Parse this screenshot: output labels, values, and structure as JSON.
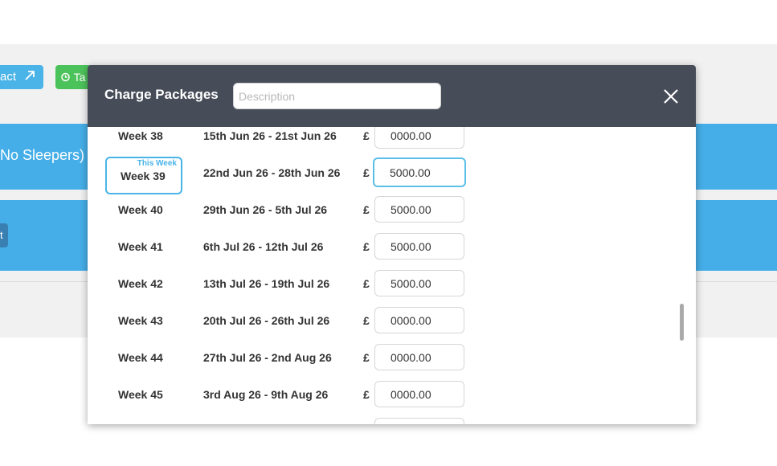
{
  "background": {
    "contract_button_label": "act",
    "task_button_label": "Ta",
    "band_label": "No Sleepers)",
    "band2_tab_label": "t"
  },
  "modal": {
    "title": "Charge Packages",
    "description_placeholder": "Description",
    "this_week_label": "This Week",
    "currency": "£",
    "rows": [
      {
        "week": "Week 38",
        "range": "15th Jun 26 - 21st Jun 26",
        "price": "0000.00"
      },
      {
        "week": "Week 39",
        "range": "22nd Jun 26 - 28th Jun 26",
        "price": "5000.00"
      },
      {
        "week": "Week 40",
        "range": "29th Jun 26 - 5th Jul 26",
        "price": "5000.00"
      },
      {
        "week": "Week 41",
        "range": "6th Jul 26 - 12th Jul 26",
        "price": "5000.00"
      },
      {
        "week": "Week 42",
        "range": "13th Jul 26 - 19th Jul 26",
        "price": "5000.00"
      },
      {
        "week": "Week 43",
        "range": "20th Jul 26 - 26th Jul 26",
        "price": "0000.00"
      },
      {
        "week": "Week 44",
        "range": "27th Jul 26 - 2nd Aug 26",
        "price": "0000.00"
      },
      {
        "week": "Week 45",
        "range": "3rd Aug 26 - 9th Aug 26",
        "price": "0000.00"
      }
    ]
  },
  "colors": {
    "header_bg": "#464c58",
    "accent_blue": "#4ab4e8",
    "green": "#4cc25a"
  }
}
